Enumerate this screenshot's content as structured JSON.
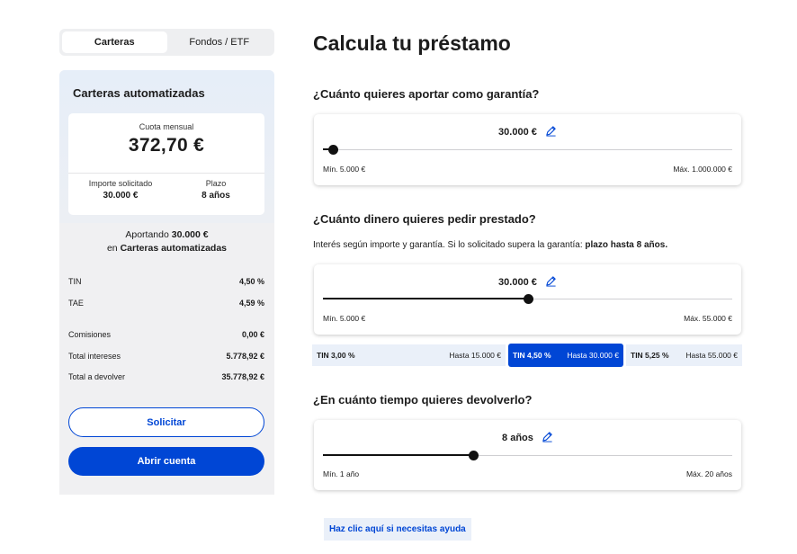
{
  "tabs": [
    {
      "label": "Carteras",
      "active": true
    },
    {
      "label": "Fondos / ETF",
      "active": false
    }
  ],
  "summary": {
    "title": "Carteras automatizadas",
    "quota_label": "Cuota mensual",
    "quota_value": "372,70 €",
    "amount_label": "Importe solicitado",
    "amount_value": "30.000 €",
    "term_label": "Plazo",
    "term_value": "8 años",
    "aport_prefix": "Aportando",
    "aport_amount": "30.000 €",
    "aport_in": "en",
    "aport_product": "Carteras automatizadas",
    "rows": [
      {
        "label": "TIN",
        "value": "4,50 %"
      },
      {
        "label": "TAE",
        "value": "4,59 %"
      },
      {
        "label": "Comisiones",
        "value": "0,00 €"
      },
      {
        "label": "Total intereses",
        "value": "5.778,92 €"
      },
      {
        "label": "Total a devolver",
        "value": "35.778,92 €"
      }
    ],
    "request_button": "Solicitar",
    "open_account_button": "Abrir cuenta"
  },
  "main": {
    "title": "Calcula tu préstamo",
    "guarantee": {
      "question": "¿Cuánto quieres aportar como garantía?",
      "value": "30.000 €",
      "min": "Mín. 5.000 €",
      "max": "Máx. 1.000.000 €",
      "level": 0.025
    },
    "loan": {
      "question": "¿Cuánto dinero quieres pedir prestado?",
      "note_text": "Interés según importe y garantía. Si lo solicitado supera la garantía:",
      "note_bold": "plazo hasta 8 años.",
      "value": "30.000 €",
      "min": "Mín. 5.000 €",
      "max": "Máx. 55.000 €",
      "level": 0.5
    },
    "tin_tiers": [
      {
        "tin": "TIN 3,00 %",
        "limit": "Hasta 15.000 €",
        "active": false
      },
      {
        "tin": "TIN 4,50 %",
        "limit": "Hasta 30.000 €",
        "active": true
      },
      {
        "tin": "TIN 5,25 %",
        "limit": "Hasta 55.000 €",
        "active": false
      }
    ],
    "term": {
      "question": "¿En cuánto tiempo quieres devolverlo?",
      "value": "8 años",
      "min": "Mín. 1 año",
      "max": "Máx. 20 años",
      "level": 0.368
    },
    "help_link": "Haz clic aquí si necesitas ayuda"
  },
  "colors": {
    "accent": "#0046d5",
    "panel_bg": "#f0f0f2",
    "tier_bg": "#eaf0f9"
  },
  "icons": {
    "edit": "pencil-icon"
  }
}
